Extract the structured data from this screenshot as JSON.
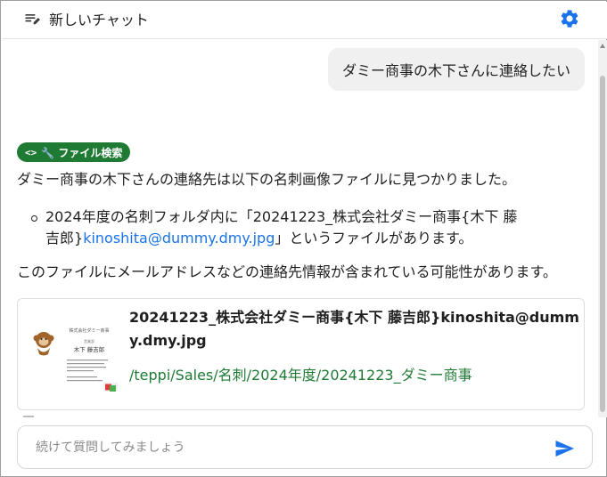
{
  "header": {
    "new_chat_label": "新しいチャット",
    "new_chat_icon": "edit-note-icon",
    "settings_icon": "gear-icon",
    "accent_color": "#1a73e8"
  },
  "chat": {
    "user_message": "ダミー商事の木下さんに連絡したい",
    "tool_badge": {
      "code_glyph": "<>",
      "label": "🔧 ファイル検索",
      "color": "#1f7a34"
    },
    "answer": {
      "intro": "ダミー商事の木下さんの連絡先は以下の名刺画像ファイルに見つかりました。",
      "bullet_prefix": "2024年度の名刺フォルダ内に「20241223_株式会社ダミー商事{木下 藤吉郎}",
      "bullet_link": "kinoshita@dummy.dmy.jpg",
      "bullet_suffix": "」というファイルがあります。",
      "conclusion": "このファイルにメールアドレスなどの連絡先情報が含まれている可能性があります。"
    },
    "file_card": {
      "title": "20241223_株式会社ダミー商事{木下 藤吉郎}kinoshita@dummy.dmy.jpg",
      "path": "/teppi/Sales/名刺/2024年度/20241223_ダミー商事",
      "thumbnail": {
        "company": "株式会社ダミー商事",
        "dept": "営業部",
        "person": "木下 藤吉郎"
      }
    }
  },
  "input": {
    "placeholder": "続けて質問してみましょう",
    "value": "",
    "send_icon": "send-icon"
  }
}
